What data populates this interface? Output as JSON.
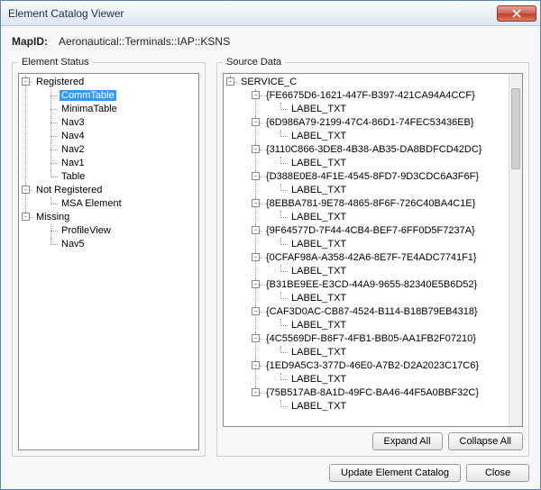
{
  "window": {
    "title": "Element Catalog Viewer"
  },
  "mapid": {
    "label": "MapID:",
    "value": "Aeronautical::Terminals::IAP::KSNS"
  },
  "panels": {
    "status_title": "Element Status",
    "source_title": "Source Data"
  },
  "status_tree": {
    "groups": [
      {
        "label": "Registered",
        "items": [
          "CommTable",
          "MinimaTable",
          "Nav3",
          "Nav4",
          "Nav2",
          "Nav1",
          "Table"
        ],
        "selected": "CommTable"
      },
      {
        "label": "Not Registered",
        "items": [
          "MSA Element"
        ]
      },
      {
        "label": "Missing",
        "items": [
          "ProfileView",
          "Nav5"
        ]
      }
    ]
  },
  "source_tree": {
    "root": "SERVICE_C",
    "child_label": "LABEL_TXT",
    "guids": [
      "{FE6675D6-1621-447F-B397-421CA94A4CCF}",
      "{6D986A79-2199-47C4-86D1-74FEC53436EB}",
      "{3110C866-3DE8-4B38-AB35-DA8BDFCD42DC}",
      "{D388E0E8-4F1E-4545-8FD7-9D3CDC6A3F6F}",
      "{8EBBA781-9E78-4865-8F6F-726C40BA4C1E}",
      "{9F64577D-7F44-4CB4-BEF7-6FF0D5F7237A}",
      "{0CFAF98A-A358-42A6-8E7F-7E4ADC7741F1}",
      "{B31BE9EE-E3CD-44A9-9655-82340E5B6D52}",
      "{CAF3D0AC-CB87-4524-B114-B18B79EB4318}",
      "{4C5569DF-B6F7-4FB1-BB05-AA1FB2F07210}",
      "{1ED9A5C3-377D-46E0-A7B2-D2A2023C17C6}",
      "{75B517AB-8A1D-49FC-BA46-44F5A0BBF32C}"
    ]
  },
  "buttons": {
    "expand_all": "Expand All",
    "collapse_all": "Collapse All",
    "update": "Update Element Catalog",
    "close": "Close"
  }
}
